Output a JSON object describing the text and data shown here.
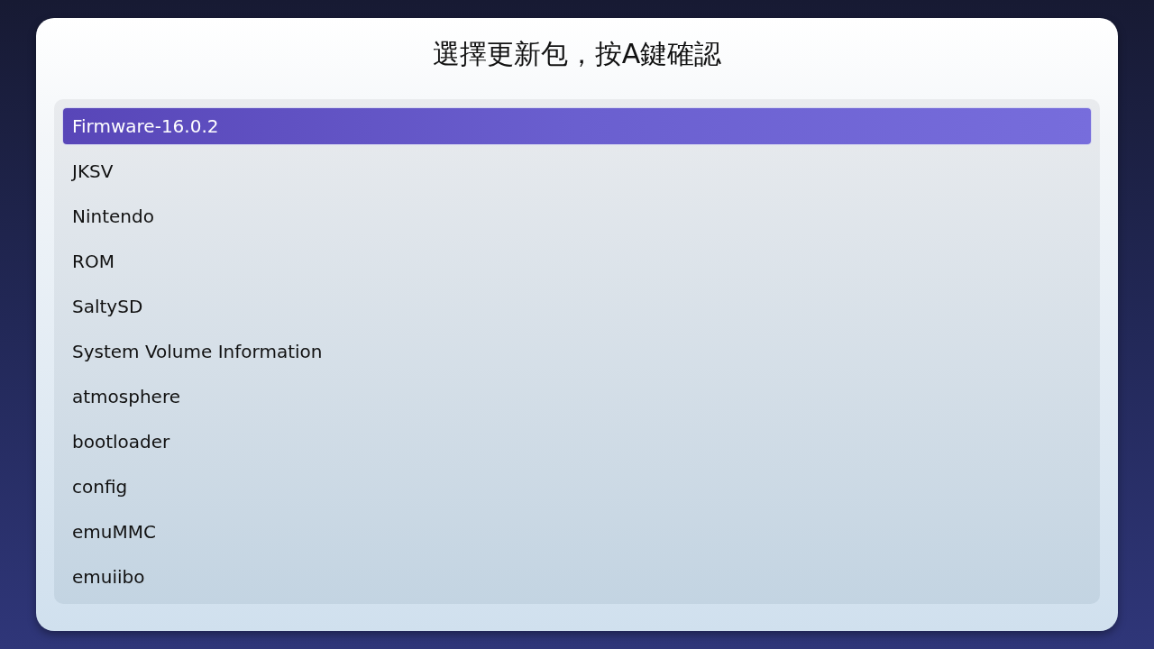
{
  "dialog": {
    "title": "選擇更新包，按A鍵確認"
  },
  "list": {
    "items": [
      {
        "label": "Firmware-16.0.2",
        "selected": true
      },
      {
        "label": "JKSV",
        "selected": false
      },
      {
        "label": "Nintendo",
        "selected": false
      },
      {
        "label": "ROM",
        "selected": false
      },
      {
        "label": "SaltySD",
        "selected": false
      },
      {
        "label": "System Volume Information",
        "selected": false
      },
      {
        "label": "atmosphere",
        "selected": false
      },
      {
        "label": "bootloader",
        "selected": false
      },
      {
        "label": "config",
        "selected": false
      },
      {
        "label": "emuMMC",
        "selected": false
      },
      {
        "label": "emuiibo",
        "selected": false
      }
    ]
  }
}
